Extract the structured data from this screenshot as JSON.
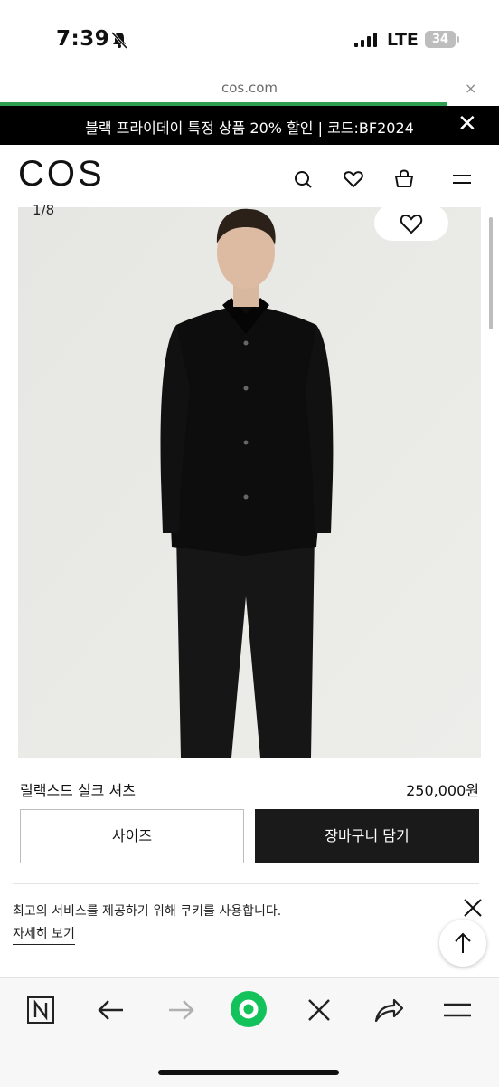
{
  "status_bar": {
    "time": "7:39",
    "network": "LTE",
    "battery": "34"
  },
  "browser": {
    "url": "cos.com",
    "close_icon": "×"
  },
  "promo": {
    "text": "블랙 프라이데이 특정 상품 20% 할인 | 코드:BF2024",
    "close_icon": "✕"
  },
  "header": {
    "logo": "COS",
    "icons": [
      "search-icon",
      "heart-icon",
      "bag-icon",
      "menu-icon"
    ]
  },
  "gallery": {
    "counter": "1/8"
  },
  "product": {
    "name": "릴랙스드 실크 셔츠",
    "price": "250,000원",
    "size_label": "사이즈",
    "cart_label": "장바구니 담기"
  },
  "cookie": {
    "message": "최고의 서비스를 제공하기 위해 쿠키를 사용합니다.",
    "link": "자세히 보기"
  },
  "toolbar": {
    "icons": [
      "n-icon",
      "back-arrow-icon",
      "forward-arrow-icon",
      "green-circle-icon",
      "close-icon",
      "share-icon",
      "hamburger-icon"
    ]
  },
  "colors": {
    "promo_bg": "#000000",
    "cart_bg": "#1a1a1a",
    "progress": "#2e9e4f",
    "toolbar_green": "#13c25a"
  }
}
